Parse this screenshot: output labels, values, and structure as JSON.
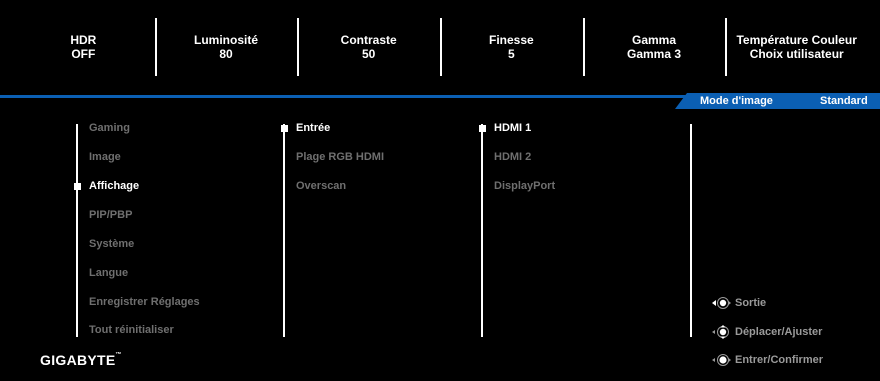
{
  "status_bar": [
    {
      "title": "HDR",
      "value": "OFF"
    },
    {
      "title": "Luminosité",
      "value": "80"
    },
    {
      "title": "Contraste",
      "value": "50"
    },
    {
      "title": "Finesse",
      "value": "5"
    },
    {
      "title": "Gamma",
      "value": "Gamma 3"
    },
    {
      "title": "Température Couleur",
      "value": "Choix utilisateur"
    }
  ],
  "mode_bar": {
    "label": "Mode d'image",
    "value": "Standard"
  },
  "main_menu": [
    {
      "label": "Gaming"
    },
    {
      "label": "Image"
    },
    {
      "label": "Affichage",
      "selected": true
    },
    {
      "label": "PIP/PBP"
    },
    {
      "label": "Système"
    },
    {
      "label": "Langue"
    },
    {
      "label": "Enregistrer Réglages"
    },
    {
      "label": "Tout réinitialiser"
    }
  ],
  "sub_menu": [
    {
      "label": "Entrée",
      "selected": true
    },
    {
      "label": "Plage RGB HDMI"
    },
    {
      "label": "Overscan"
    }
  ],
  "options_menu": [
    {
      "label": "HDMI 1",
      "selected": true
    },
    {
      "label": "HDMI 2"
    },
    {
      "label": "DisplayPort"
    }
  ],
  "help": [
    {
      "icon": "joystick-left-icon",
      "label": "Sortie"
    },
    {
      "icon": "joystick-updown-icon",
      "label": "Déplacer/Ajuster"
    },
    {
      "icon": "joystick-press-icon",
      "label": "Entrer/Confirmer"
    }
  ],
  "brand": {
    "logo": "GIGABYTE",
    "tm": "™"
  },
  "colors": {
    "accent": "#0b5fb3",
    "inactive": "#6f6f6f",
    "active": "#ffffff",
    "background": "#000000"
  }
}
